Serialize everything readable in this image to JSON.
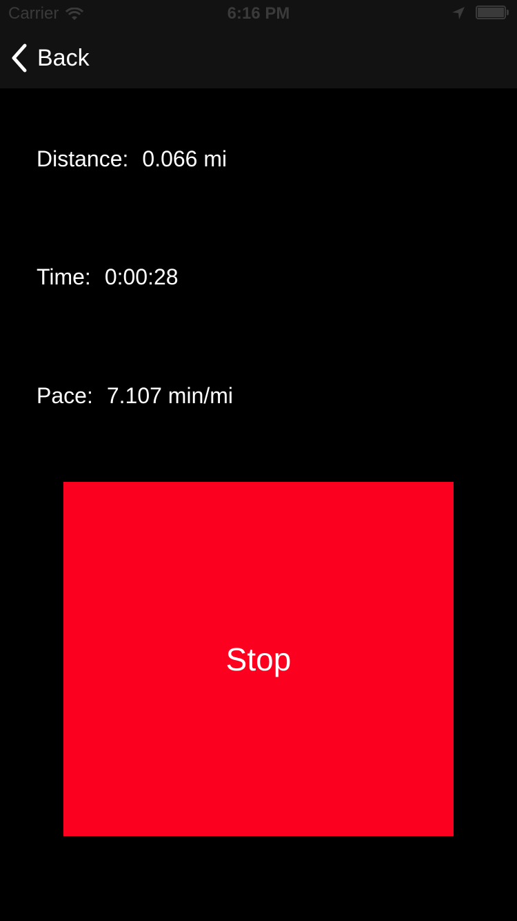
{
  "status_bar": {
    "carrier": "Carrier",
    "time": "6:16 PM",
    "icons": [
      "wifi-icon",
      "location-icon",
      "battery-icon"
    ]
  },
  "nav": {
    "back_label": "Back",
    "back_icon": "chevron-left-icon"
  },
  "stats": {
    "distance_label": "Distance:",
    "distance_value": "0.066 mi",
    "time_label": "Time:",
    "time_value": "0:00:28",
    "pace_label": "Pace:",
    "pace_value": "7.107 min/mi"
  },
  "stop_button": {
    "label": "Stop"
  },
  "colors": {
    "background": "#000000",
    "nav_background": "#121212",
    "stop_button": "#fc001f",
    "text": "#ffffff"
  }
}
